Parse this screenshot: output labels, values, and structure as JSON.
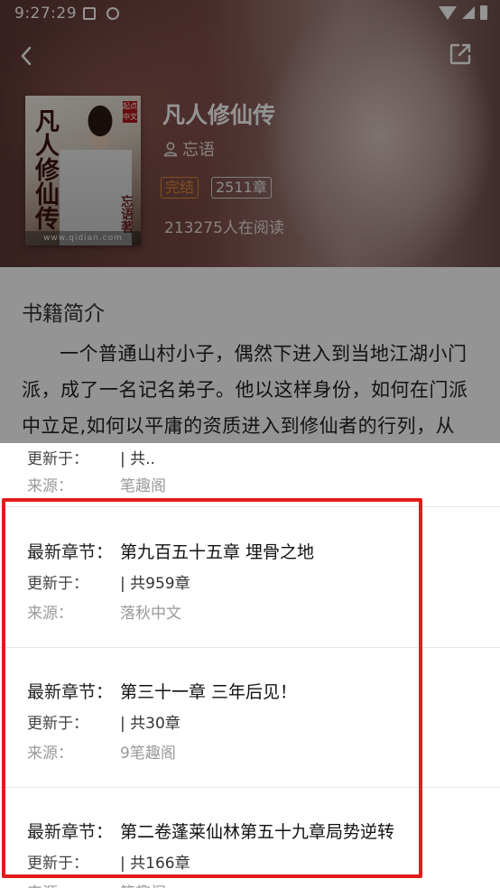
{
  "status_bar": {
    "time": "9:27:29"
  },
  "book": {
    "title": "凡人修仙传",
    "author": "忘语",
    "status_tag": "完结",
    "chapters_tag": "2511章",
    "readers": "213275人在阅读",
    "cover": {
      "title": "凡人修仙传",
      "author": "忘语著",
      "site": "www.qidian.com",
      "badge": "起点中文"
    }
  },
  "intro": {
    "heading": "书籍简介",
    "text": "一个普通山村小子，偶然下进入到当地江湖小门派，成了一名记名弟子。他以这样身份，如何在门派中立足,如何以平庸的资质进入到修仙者的行列，从"
  },
  "sheet": {
    "partial_top": {
      "updated_label": "更新于：",
      "updated_value": "| 共..",
      "source_label": "来源：",
      "source_value": "笔趣阁"
    },
    "items": [
      {
        "latest_label": "最新章节：",
        "latest_value": "第九百五十五章 埋骨之地",
        "updated_label": "更新于：",
        "updated_value": "| 共959章",
        "source_label": "来源：",
        "source_value": "落秋中文"
      },
      {
        "latest_label": "最新章节：",
        "latest_value": "第三十一章 三年后见！",
        "updated_label": "更新于：",
        "updated_value": "| 共30章",
        "source_label": "来源：",
        "source_value": "9笔趣阁"
      },
      {
        "latest_label": "最新章节：",
        "latest_value": "第二卷蓬莱仙林第五十九章局势逆转",
        "updated_label": "更新于：",
        "updated_value": "| 共166章",
        "source_label": "来源：",
        "source_value": "笔趣阁"
      }
    ]
  },
  "colors": {
    "accent_orange": "#e08a36",
    "highlight_red": "#e21b1b"
  }
}
